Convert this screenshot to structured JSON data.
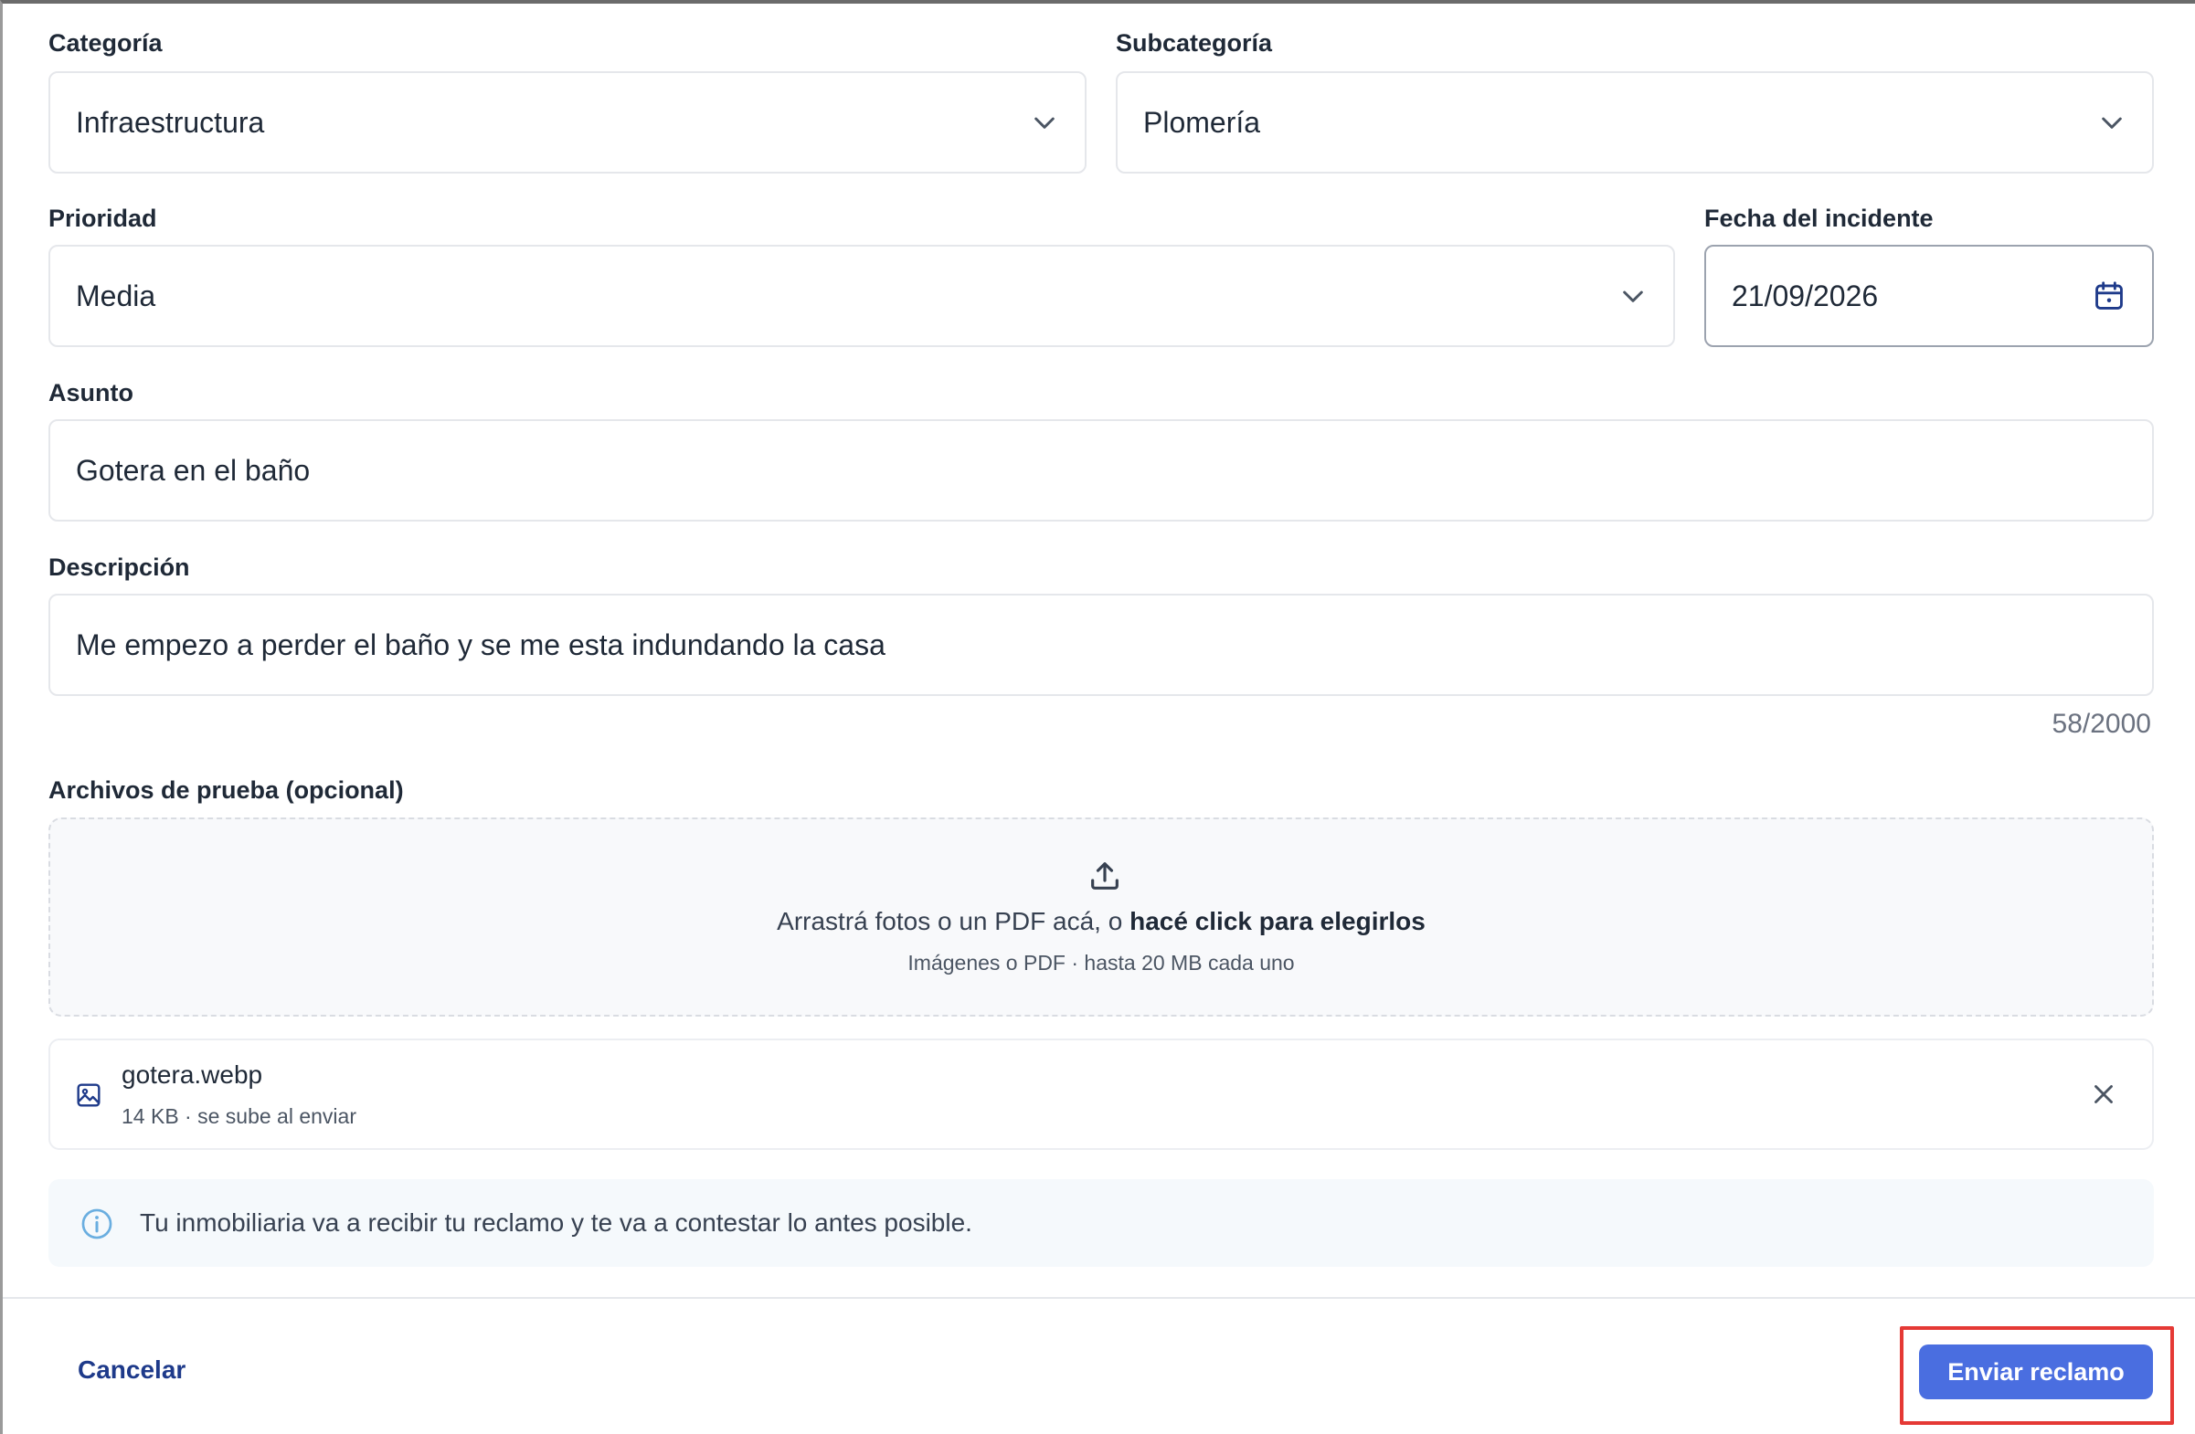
{
  "colors": {
    "primary": "#4a6ee0",
    "link": "#1e3a8a",
    "highlight": "#e53935",
    "border": "#e5e7eb"
  },
  "form": {
    "categoria": {
      "label": "Categoría",
      "value": "Infraestructura"
    },
    "subcategoria": {
      "label": "Subcategoría",
      "value": "Plomería"
    },
    "prioridad": {
      "label": "Prioridad",
      "value": "Media"
    },
    "fecha": {
      "label": "Fecha del incidente",
      "value": "21/09/2026"
    },
    "asunto": {
      "label": "Asunto",
      "value": "Gotera en el baño"
    },
    "descripcion": {
      "label": "Descripción",
      "value": "Me empezo a perder el baño y se me esta indundando la casa",
      "counter": "58/2000"
    }
  },
  "attachments": {
    "label": "Archivos de prueba (opcional)",
    "dropzone": {
      "icon": "upload-icon",
      "text_prefix": "Arrastrá fotos o un PDF acá, o ",
      "text_link": "hacé click para elegirlos",
      "hint": "Imágenes o PDF · hasta 20 MB cada uno"
    },
    "files": [
      {
        "icon": "image-file-icon",
        "name": "gotera.webp",
        "meta": "14 KB · se sube al enviar"
      }
    ]
  },
  "notice": {
    "icon": "info-icon",
    "text": "Tu inmobiliaria va a recibir tu reclamo y te va a contestar lo antes posible."
  },
  "footer": {
    "cancel_label": "Cancelar",
    "submit_label": "Enviar reclamo"
  }
}
